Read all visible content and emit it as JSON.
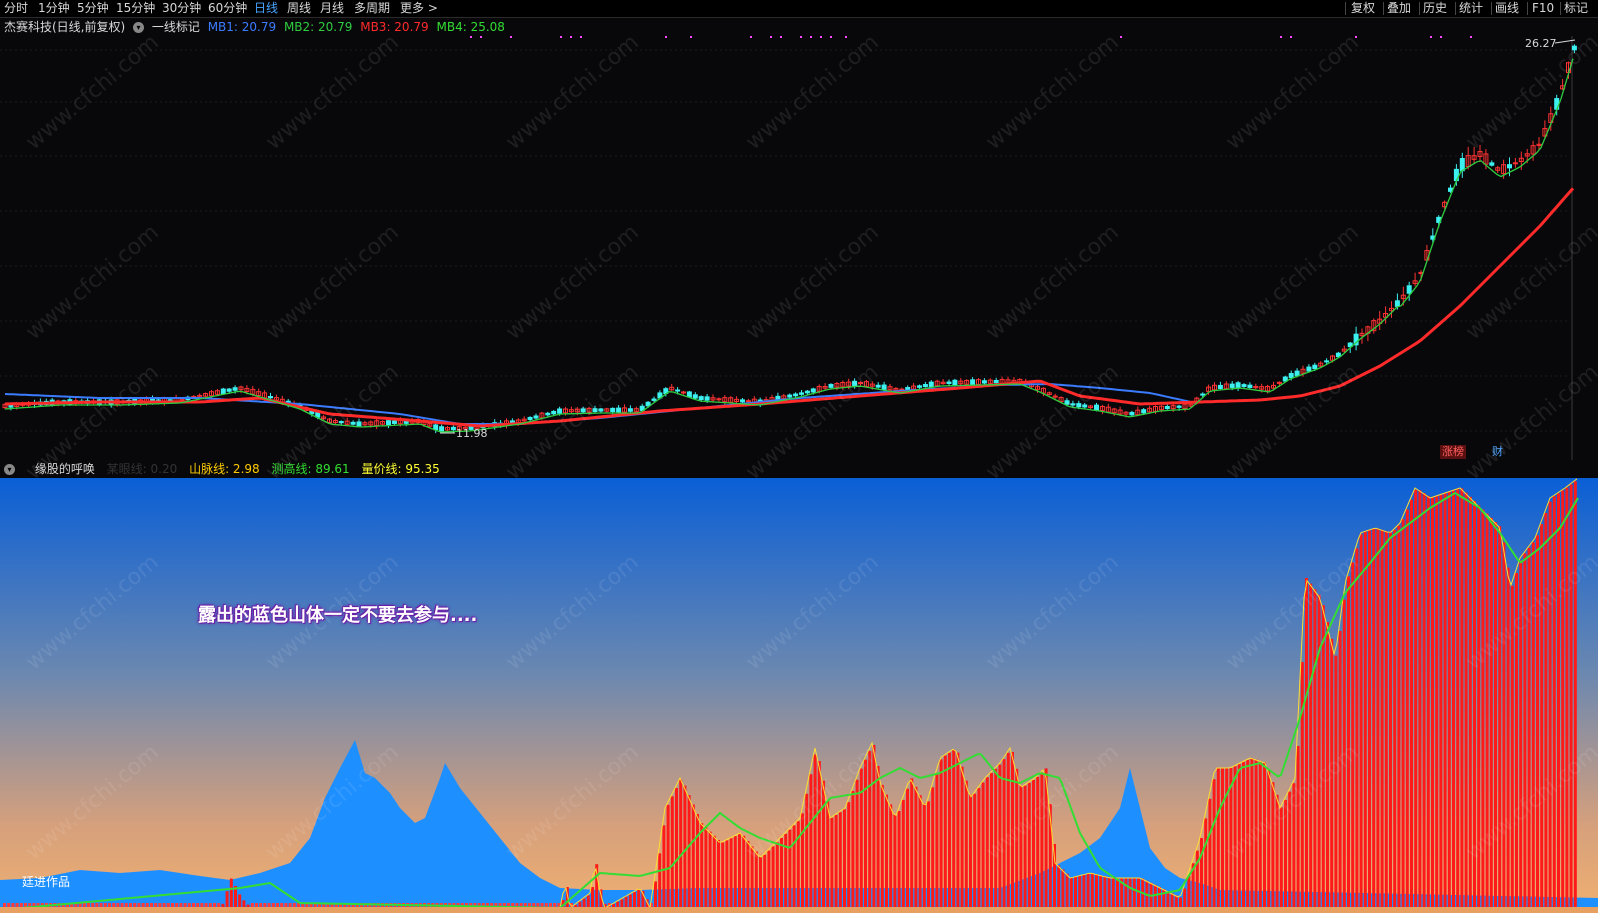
{
  "toolbar": {
    "periods": [
      "分时",
      "1分钟",
      "5分钟",
      "15分钟",
      "30分钟",
      "60分钟",
      "日线",
      "周线",
      "月线",
      "多周期",
      "更多 >"
    ],
    "active_period": "日线",
    "right_tools": [
      "复权",
      "叠加",
      "历史",
      "统计",
      "画线",
      "F10",
      "标记"
    ]
  },
  "main": {
    "stock_title": "杰赛科技(日线,前复权)",
    "indicator_name": "一线标记",
    "mb1": "MB1: 20.79",
    "mb2": "MB2: 20.79",
    "mb3": "MB3: 20.79",
    "mb4": "MB4: 25.08",
    "high_label": "26.27",
    "low_label": "11.98",
    "badge_limit": "涨榜",
    "badge_finance": "财",
    "colors": {
      "mb1": "#3b7cff",
      "mb2": "#2ecc40",
      "mb3": "#ff2a2a",
      "mb4": "#33dd33",
      "up": "#ff3333",
      "down": "#3cf0f0"
    }
  },
  "sub": {
    "indicator_name": "缘股的呼唤",
    "hidden_line": "某眼线: 0.20",
    "shanmai": "山脉线: 2.98",
    "cegao": "测高线: 89.61",
    "liangjia": "量价线: 95.35",
    "callout": "露出的蓝色山体一定不要去参与....",
    "author": "廷进作品",
    "colors": {
      "shanmai": "#ffcc00",
      "cegao": "#33dd33",
      "liangjia": "#ffff33"
    }
  },
  "watermark": "www.cfchi.com"
}
